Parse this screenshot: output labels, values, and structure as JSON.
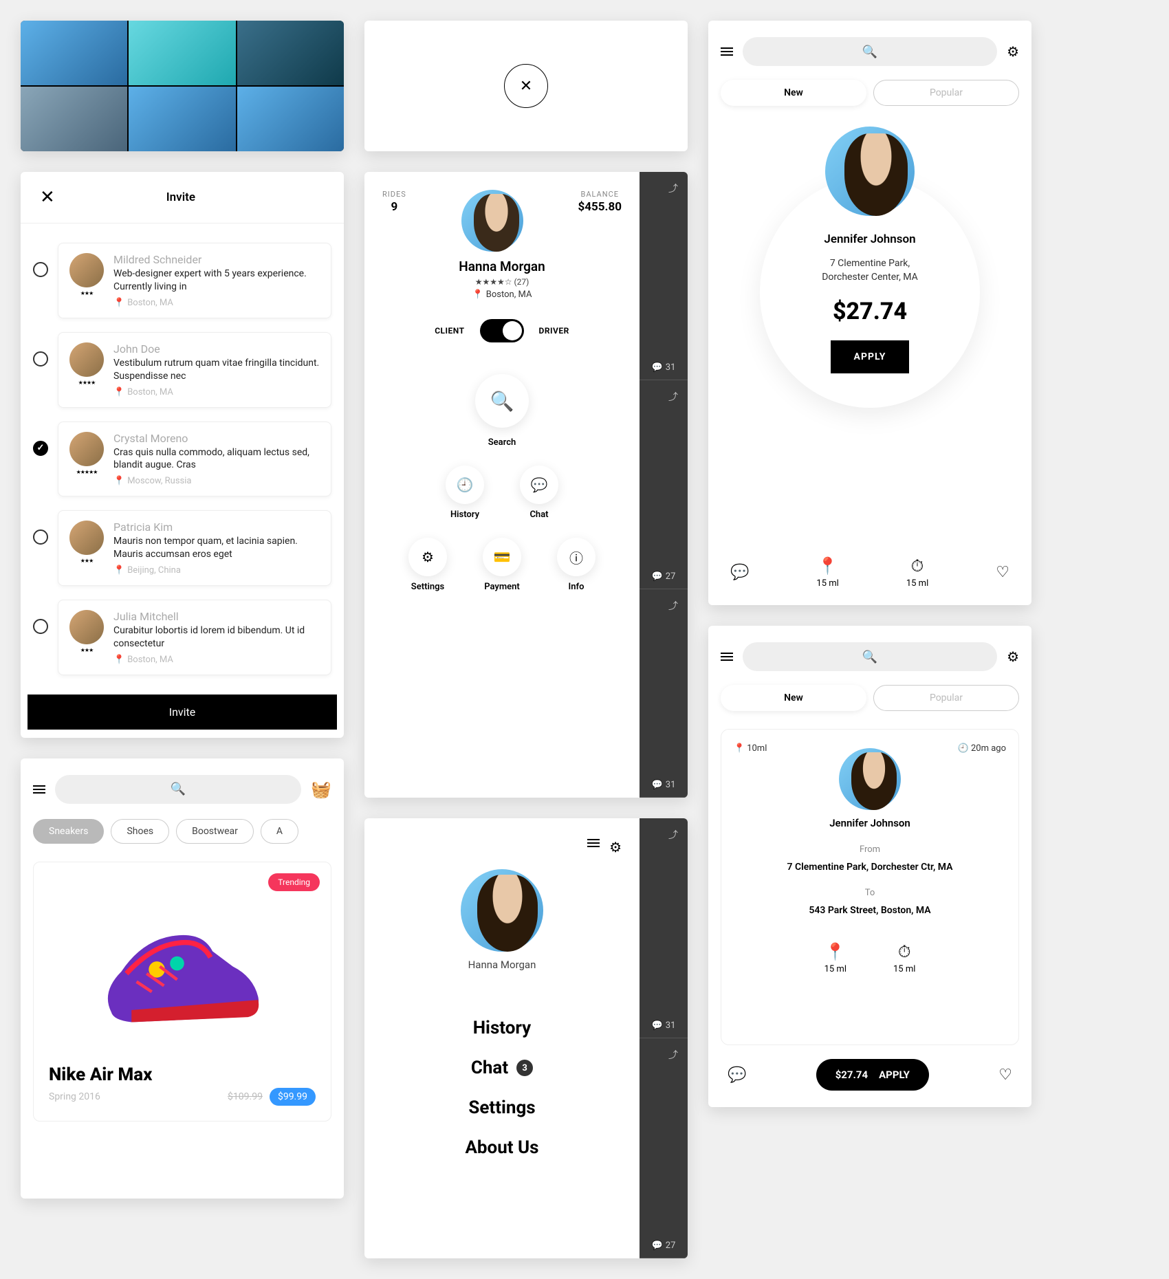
{
  "invite": {
    "title": "Invite",
    "button": "Invite",
    "people": [
      {
        "name": "Mildred Schneider",
        "desc": "Web-designer expert with 5 years experience. Currently living in",
        "loc": "Boston, MA",
        "stars": "★★★",
        "checked": false
      },
      {
        "name": "John Doe",
        "desc": "Vestibulum rutrum quam vitae fringilla tincidunt. Suspendisse nec",
        "loc": "Boston, MA",
        "stars": "★★★★",
        "checked": false
      },
      {
        "name": "Crystal Moreno",
        "desc": "Cras quis nulla commodo, aliquam lectus sed, blandit augue. Cras",
        "loc": "Moscow, Russia",
        "stars": "★★★★★",
        "checked": true
      },
      {
        "name": "Patricia Kim",
        "desc": "Mauris non tempor quam, et lacinia sapien. Mauris accumsan eros eget",
        "loc": "Beijing, China",
        "stars": "★★★",
        "checked": false
      },
      {
        "name": "Julia Mitchell",
        "desc": "Curabitur lobortis id lorem id bibendum. Ut id consectetur",
        "loc": "Boston, MA",
        "stars": "★★★",
        "checked": false
      }
    ]
  },
  "profile": {
    "name": "Hanna Morgan",
    "rating": "★★★★☆ (27)",
    "location": "Boston, MA",
    "rides_label": "RIDES",
    "rides": "9",
    "balance_label": "BALANCE",
    "balance": "$455.80",
    "client": "CLIENT",
    "driver": "DRIVER",
    "actions": {
      "search": "Search",
      "history": "History",
      "chat": "Chat",
      "settings": "Settings",
      "payment": "Payment",
      "info": "Info"
    },
    "feed_counts": [
      "31",
      "27",
      "31"
    ]
  },
  "jen1": {
    "tabs": {
      "new": "New",
      "popular": "Popular"
    },
    "name": "Jennifer Johnson",
    "addr1": "7 Clementine Park,",
    "addr2": "Dorchester Center, MA",
    "price": "$27.74",
    "apply": "APPLY",
    "dist": "15 ml",
    "time": "15 ml"
  },
  "shop": {
    "chips": [
      "Sneakers",
      "Shoes",
      "Boostwear",
      "A"
    ],
    "trending": "Trending",
    "product": "Nike Air Max",
    "season": "Spring 2016",
    "old": "$109.99",
    "new": "$99.99"
  },
  "drawer": {
    "name": "Hanna Morgan",
    "links": [
      "History",
      "Chat",
      "Settings",
      "About Us"
    ],
    "chat_badge": "3",
    "feed_counts": [
      "31",
      "27"
    ]
  },
  "ride": {
    "tabs": {
      "new": "New",
      "popular": "Popular"
    },
    "distance": "10ml",
    "ago": "20m ago",
    "name": "Jennifer Johnson",
    "from_label": "From",
    "from": "7 Clementine Park, Dorchester Ctr, MA",
    "to_label": "To",
    "to": "543 Park Street, Boston, MA",
    "m1": "15 ml",
    "m2": "15 ml",
    "price": "$27.74",
    "apply": "APPLY"
  }
}
